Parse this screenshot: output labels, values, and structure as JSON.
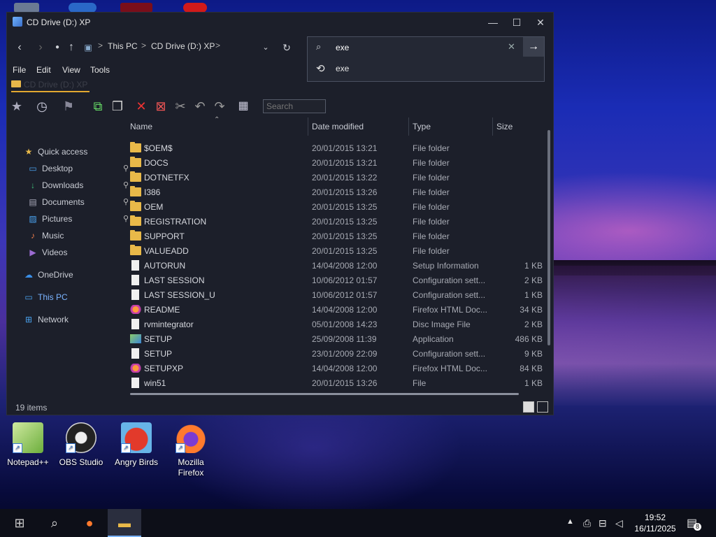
{
  "window": {
    "title": "CD Drive (D:) XP",
    "controls": {
      "minimize": "—",
      "maximize": "☐",
      "close": "✕"
    }
  },
  "address": {
    "breadcrumbs": [
      "This PC",
      "CD Drive (D:) XP"
    ],
    "separator": ">"
  },
  "search": {
    "value": "exe",
    "suggestion": "exe"
  },
  "menu": [
    "File",
    "Edit",
    "View",
    "Tools"
  ],
  "tab": {
    "label": "CD Drive (D:) XP"
  },
  "toolbar": {
    "search_placeholder": "Search"
  },
  "nav_pane": {
    "items": [
      {
        "label": "Quick access",
        "icon": "star-icon",
        "pinned": false
      },
      {
        "label": "Desktop",
        "icon": "desktop-icon",
        "pinned": true
      },
      {
        "label": "Downloads",
        "icon": "download-icon",
        "pinned": true
      },
      {
        "label": "Documents",
        "icon": "documents-icon",
        "pinned": true
      },
      {
        "label": "Pictures",
        "icon": "pictures-icon",
        "pinned": true
      },
      {
        "label": "Music",
        "icon": "music-icon",
        "pinned": false
      },
      {
        "label": "Videos",
        "icon": "videos-icon",
        "pinned": false
      },
      {
        "label": "OneDrive",
        "icon": "cloud-icon",
        "pinned": false
      },
      {
        "label": "This PC",
        "icon": "computer-icon",
        "pinned": false
      },
      {
        "label": "Network",
        "icon": "network-icon",
        "pinned": false
      }
    ]
  },
  "columns": [
    "Name",
    "Date modified",
    "Type",
    "Size"
  ],
  "files": [
    {
      "name": "$OEM$",
      "date": "20/01/2015 13:21",
      "type": "File folder",
      "size": "",
      "kind": "folder"
    },
    {
      "name": "DOCS",
      "date": "20/01/2015 13:21",
      "type": "File folder",
      "size": "",
      "kind": "folder"
    },
    {
      "name": "DOTNETFX",
      "date": "20/01/2015 13:22",
      "type": "File folder",
      "size": "",
      "kind": "folder"
    },
    {
      "name": "I386",
      "date": "20/01/2015 13:26",
      "type": "File folder",
      "size": "",
      "kind": "folder"
    },
    {
      "name": "OEM",
      "date": "20/01/2015 13:25",
      "type": "File folder",
      "size": "",
      "kind": "folder"
    },
    {
      "name": "REGISTRATION",
      "date": "20/01/2015 13:25",
      "type": "File folder",
      "size": "",
      "kind": "folder"
    },
    {
      "name": "SUPPORT",
      "date": "20/01/2015 13:25",
      "type": "File folder",
      "size": "",
      "kind": "folder"
    },
    {
      "name": "VALUEADD",
      "date": "20/01/2015 13:25",
      "type": "File folder",
      "size": "",
      "kind": "folder"
    },
    {
      "name": "AUTORUN",
      "date": "14/04/2008 12:00",
      "type": "Setup Information",
      "size": "1 KB",
      "kind": "config"
    },
    {
      "name": "LAST SESSION",
      "date": "10/06/2012 01:57",
      "type": "Configuration sett...",
      "size": "2 KB",
      "kind": "config"
    },
    {
      "name": "LAST SESSION_U",
      "date": "10/06/2012 01:57",
      "type": "Configuration sett...",
      "size": "1 KB",
      "kind": "config"
    },
    {
      "name": "README",
      "date": "14/04/2008 12:00",
      "type": "Firefox HTML Doc...",
      "size": "34 KB",
      "kind": "firefox"
    },
    {
      "name": "rvmintegrator",
      "date": "05/01/2008 14:23",
      "type": "Disc Image File",
      "size": "2 KB",
      "kind": "doc"
    },
    {
      "name": "SETUP",
      "date": "25/09/2008 11:39",
      "type": "Application",
      "size": "486 KB",
      "kind": "app"
    },
    {
      "name": "SETUP",
      "date": "23/01/2009 22:09",
      "type": "Configuration sett...",
      "size": "9 KB",
      "kind": "config"
    },
    {
      "name": "SETUPXP",
      "date": "14/04/2008 12:00",
      "type": "Firefox HTML Doc...",
      "size": "84 KB",
      "kind": "firefox"
    },
    {
      "name": "win51",
      "date": "20/01/2015 13:26",
      "type": "File",
      "size": "1 KB",
      "kind": "doc"
    }
  ],
  "status": {
    "item_count": "19 items"
  },
  "desktop_icons": [
    {
      "label": "Notepad++",
      "icon": "notepadpp-icon"
    },
    {
      "label": "OBS Studio",
      "icon": "obs-icon"
    },
    {
      "label": "Angry Birds",
      "icon": "angry-birds-icon"
    },
    {
      "label": "Mozilla Firefox",
      "icon": "firefox-icon"
    }
  ],
  "taskbar": {
    "time": "19:52",
    "date": "16/11/2025",
    "notification_count": "8"
  }
}
